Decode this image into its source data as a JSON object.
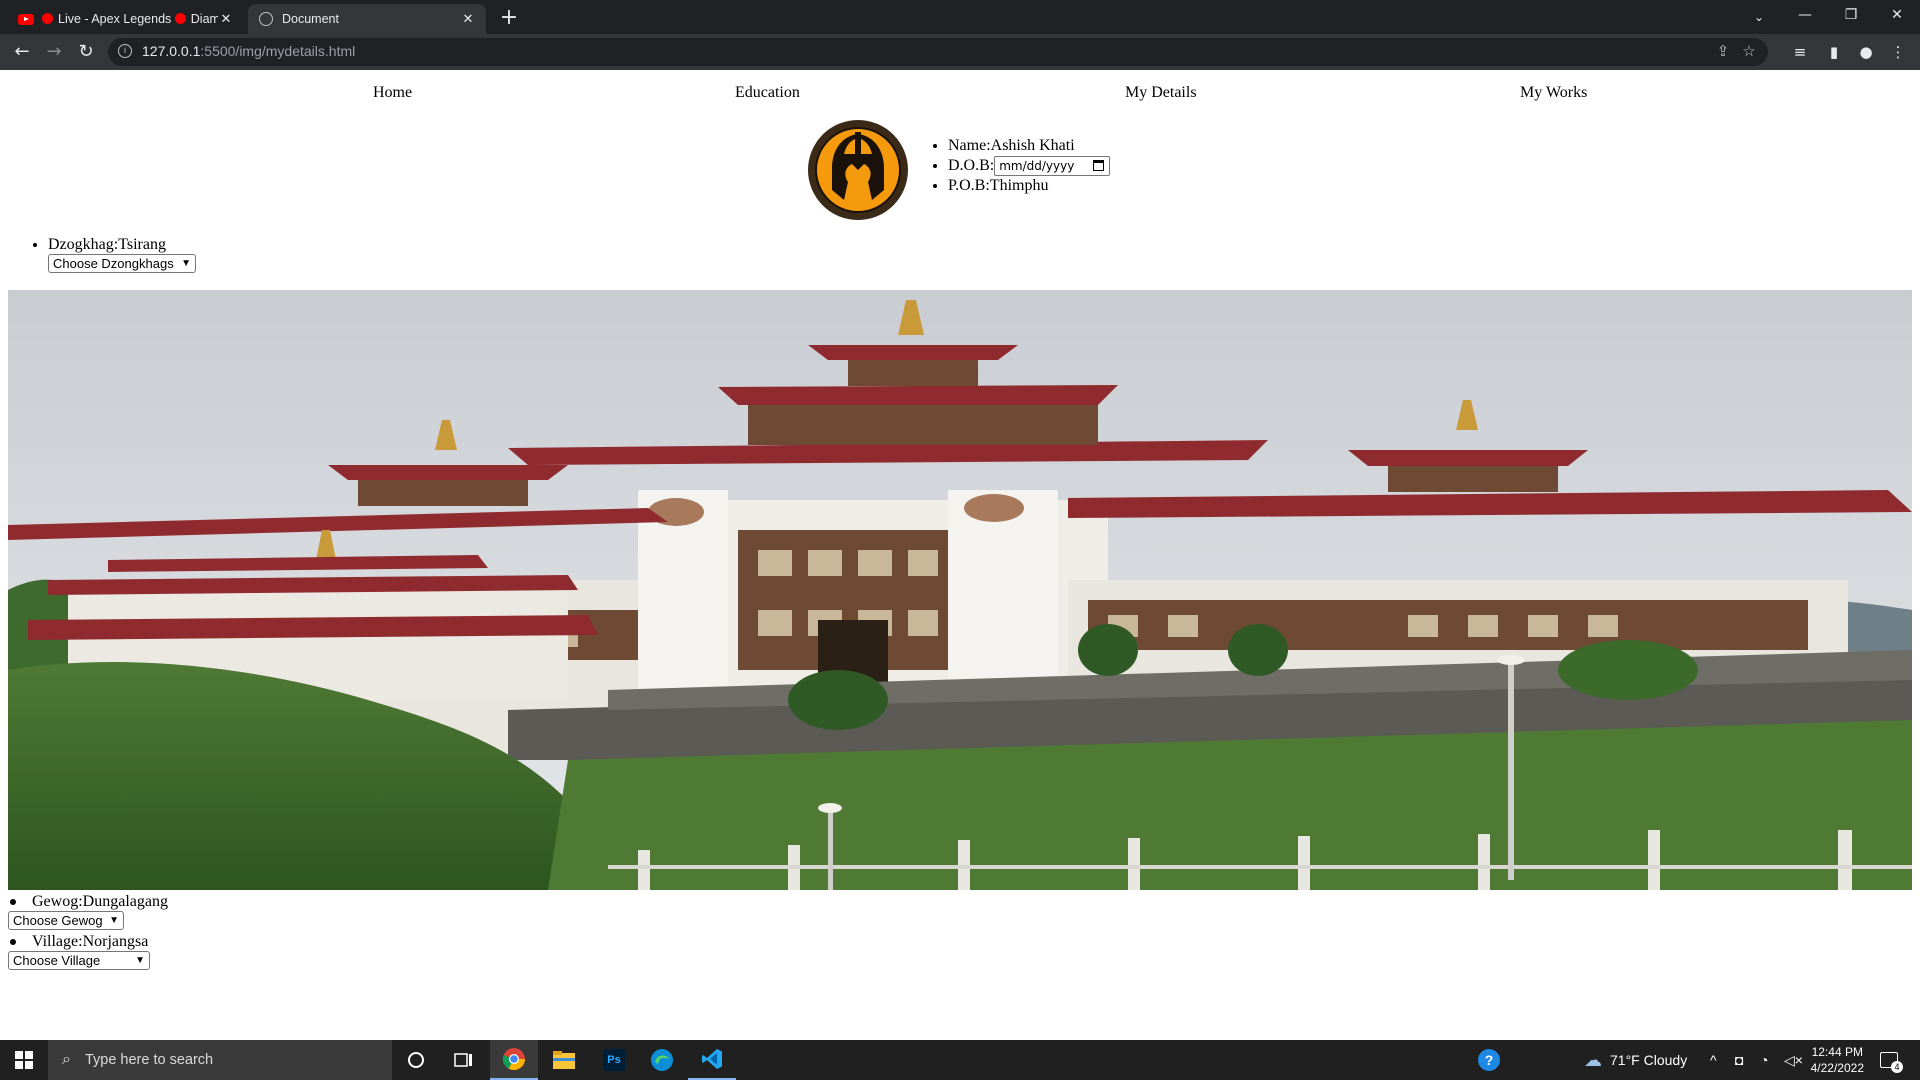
{
  "browser": {
    "tabs": [
      {
        "title_prefix": "Live - Apex Legends",
        "title_suffix": "Diam",
        "active": false
      },
      {
        "title": "Document",
        "active": true
      }
    ],
    "url_host": "127.0.0.1",
    "url_path": ":5500/img/mydetails.html"
  },
  "page": {
    "nav": [
      "Home",
      "Education",
      "My Details",
      "My Works"
    ],
    "details": {
      "name": "Name:Ashish Khati",
      "dob_label": "D.O.B:",
      "dob_placeholder": "mm/dd/yyyy",
      "pob": "P.O.B:Thimphu"
    },
    "dzongkhag": {
      "label": "Dzogkhag:Tsirang",
      "select": "Choose Dzongkhags"
    },
    "gewog": {
      "label": "Gewog:Dungalagang",
      "select": "Choose Gewog"
    },
    "village": {
      "label": "Village:Norjangsa",
      "select": "Choose Village"
    }
  },
  "taskbar": {
    "search_placeholder": "Type here to search",
    "weather": "71°F  Cloudy",
    "time": "12:44 PM",
    "date": "4/22/2022",
    "notifications": "4"
  },
  "colors": {
    "logo_orange": "#f59a0c",
    "logo_ring": "#3b2a18",
    "vscode_blue": "#23a9f2",
    "ps_blue": "#31a8ff"
  }
}
